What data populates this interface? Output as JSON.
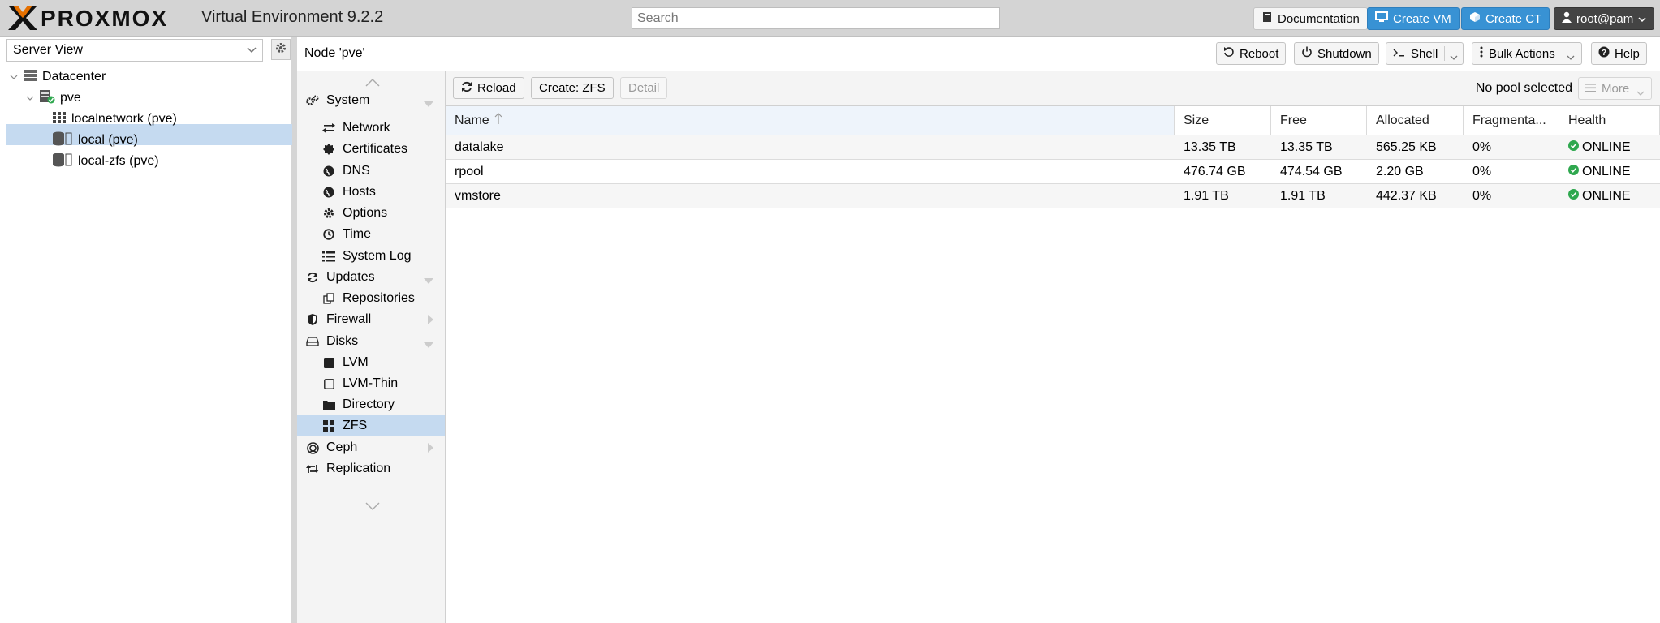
{
  "topbar": {
    "brand": "PROXMOX",
    "version_label": "Virtual Environment 9.2.2",
    "search_placeholder": "Search",
    "documentation": "Documentation",
    "create_vm": "Create VM",
    "create_ct": "Create CT",
    "user": "root@pam"
  },
  "tree": {
    "view_selector": "Server View",
    "datacenter": "Datacenter",
    "node": "pve",
    "items": [
      "localnetwork (pve)",
      "local (pve)",
      "local-zfs (pve)"
    ]
  },
  "node_panel": {
    "title": "Node 'pve'",
    "reboot": "Reboot",
    "shutdown": "Shutdown",
    "shell": "Shell",
    "bulk_actions": "Bulk Actions",
    "help": "Help"
  },
  "nav": {
    "system": "System",
    "network": "Network",
    "certificates": "Certificates",
    "dns": "DNS",
    "hosts": "Hosts",
    "options": "Options",
    "time": "Time",
    "system_log": "System Log",
    "updates": "Updates",
    "repositories": "Repositories",
    "firewall": "Firewall",
    "disks": "Disks",
    "lvm": "LVM",
    "lvm_thin": "LVM-Thin",
    "directory": "Directory",
    "zfs": "ZFS",
    "ceph": "Ceph",
    "replication": "Replication",
    "selected": "ZFS"
  },
  "toolbar": {
    "reload": "Reload",
    "create_zfs": "Create: ZFS",
    "detail": "Detail",
    "no_pool": "No pool selected",
    "more": "More"
  },
  "grid": {
    "columns": [
      "Name",
      "Size",
      "Free",
      "Allocated",
      "Fragmenta...",
      "Health"
    ],
    "rows": [
      {
        "name": "datalake",
        "size": "13.35 TB",
        "free": "13.35 TB",
        "allocated": "565.25 KB",
        "frag": "0%",
        "health": "ONLINE"
      },
      {
        "name": "rpool",
        "size": "476.74 GB",
        "free": "474.54 GB",
        "allocated": "2.20 GB",
        "frag": "0%",
        "health": "ONLINE"
      },
      {
        "name": "vmstore",
        "size": "1.91 TB",
        "free": "1.91 TB",
        "allocated": "442.37 KB",
        "frag": "0%",
        "health": "ONLINE"
      }
    ]
  },
  "colors": {
    "accent_blue": "#3892d4",
    "selection": "#c5daf0",
    "status_ok": "#2fa84f",
    "brand_orange": "#e57000"
  }
}
